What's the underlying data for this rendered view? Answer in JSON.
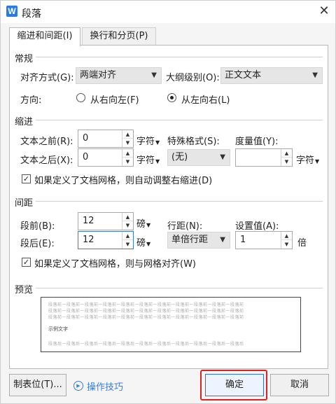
{
  "window": {
    "title": "段落",
    "app_icon": "W",
    "close_glyph": "✕"
  },
  "tabs": [
    {
      "label": "缩进和间距(I)",
      "active": true
    },
    {
      "label": "换行和分页(P)",
      "active": false
    }
  ],
  "general": {
    "section": "常规",
    "align_label": "对齐方式(G):",
    "align_value": "两端对齐",
    "outline_label": "大纲级别(O):",
    "outline_value": "正文文本",
    "direction_label": "方向:",
    "rtl_label": "从右向左(F)",
    "ltr_label": "从左向右(L)",
    "direction_selected": "ltr"
  },
  "indent": {
    "section": "缩进",
    "before_label": "文本之前(R):",
    "before_value": "0",
    "before_unit": "字符",
    "after_label": "文本之后(X):",
    "after_value": "0",
    "after_unit": "字符",
    "special_label": "特殊格式(S):",
    "special_value": "(无)",
    "measure_label": "度量值(Y):",
    "measure_value": "",
    "measure_unit": "字符",
    "auto_adjust_label": "如果定义了文档网格，则自动调整右缩进(D)",
    "auto_adjust_checked": true
  },
  "spacing": {
    "section": "间距",
    "before_label": "段前(B):",
    "before_value": "12",
    "before_unit": "磅",
    "after_label": "段后(E):",
    "after_value": "12",
    "after_unit": "磅",
    "line_label": "行距(N):",
    "line_value": "单倍行距",
    "setting_label": "设置值(A):",
    "setting_value": "1",
    "setting_unit": "倍",
    "grid_align_label": "如果定义了文档网格，则与网格对齐(W)",
    "grid_align_checked": true
  },
  "preview": {
    "section": "预览",
    "filler": "段落前一段落前一段落前一段落前一段落前一段落前一段落前一段落前一段落前一段落前一段落前",
    "sample": "示例文字",
    "after_filler": "段落后一段落后一段落后一段落后一段落后一段落后一段落后一段落后一段落后一段落后一段落后"
  },
  "footer": {
    "tabs_button": "制表位(T)...",
    "tips_label": "操作技巧",
    "ok_button": "确定",
    "cancel_button": "取消"
  },
  "colors": {
    "accent": "#3d7de0",
    "highlight": "#e02020"
  }
}
